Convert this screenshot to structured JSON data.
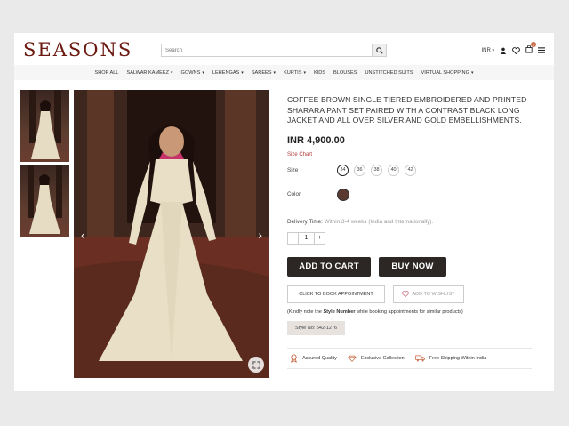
{
  "header": {
    "logo": "SEASONS",
    "search_placeholder": "Search",
    "currency": "INR",
    "cart_count": "0"
  },
  "nav": [
    {
      "label": "SHOP ALL",
      "dropdown": false
    },
    {
      "label": "SALWAR KAMEEZ",
      "dropdown": true
    },
    {
      "label": "GOWNS",
      "dropdown": true
    },
    {
      "label": "LEHENGAS",
      "dropdown": true
    },
    {
      "label": "SAREES",
      "dropdown": true
    },
    {
      "label": "KURTIS",
      "dropdown": true
    },
    {
      "label": "KIDS",
      "dropdown": false
    },
    {
      "label": "BLOUSES",
      "dropdown": false
    },
    {
      "label": "UNSTITCHED SUITS",
      "dropdown": false
    },
    {
      "label": "VIRTUAL SHOPPING",
      "dropdown": true
    }
  ],
  "product": {
    "title": "COFFEE BROWN SINGLE TIERED EMBROIDERED AND PRINTED SHARARA PANT SET PAIRED WITH A CONTRAST BLACK LONG JACKET AND ALL OVER SILVER AND GOLD EMBELLISHMENTS.",
    "price": "INR 4,900.00",
    "size_chart": "Size Chart",
    "size_label": "Size",
    "sizes": [
      "34",
      "36",
      "38",
      "40",
      "42"
    ],
    "selected_size": "34",
    "color_label": "Color",
    "color_hex": "#5a3a30",
    "delivery_label": "Delivery Time:",
    "delivery_value": "Within 3-4 weeks (India and Internationally).",
    "quantity": "1",
    "qty_minus": "-",
    "qty_plus": "+",
    "add_to_cart": "ADD TO CART",
    "buy_now": "BUY NOW",
    "book_appointment": "CLICK TO BOOK APPOINTMENT",
    "add_to_wishlist": "ADD TO WISHLIST",
    "note_prefix": "(Kindly note the ",
    "note_bold": "Style Number",
    "note_suffix": " while booking appointments for similar products)",
    "style_no": "Style No: 542-1276"
  },
  "features": [
    {
      "icon": "quality-badge-icon",
      "label": "Assured Quality"
    },
    {
      "icon": "diamond-icon",
      "label": "Exclusive Collection"
    },
    {
      "icon": "truck-icon",
      "label": "Free Shipping Within India"
    }
  ],
  "colors": {
    "brand": "#6b1a12",
    "button_dark": "#2c2624",
    "gown": "#e8dfc6"
  }
}
